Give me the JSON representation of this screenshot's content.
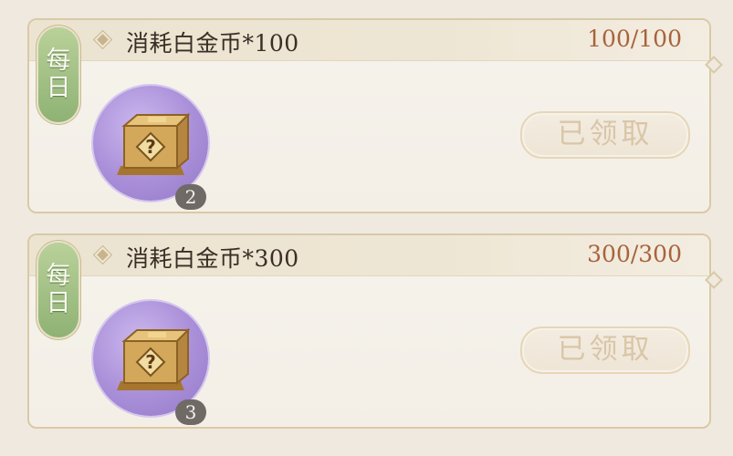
{
  "tasks": [
    {
      "tag_line1": "每",
      "tag_line2": "日",
      "title": "消耗白金币*100",
      "progress": "100/100",
      "reward_icon": "golden-mystery-box-icon",
      "reward_count": "2",
      "button_label": "已领取"
    },
    {
      "tag_line1": "每",
      "tag_line2": "日",
      "title": "消耗白金币*300",
      "progress": "300/300",
      "reward_icon": "golden-mystery-box-icon",
      "reward_count": "3",
      "button_label": "已领取"
    }
  ],
  "colors": {
    "progress_text": "#a8633c",
    "tag_green": "#9dbd80",
    "circle_purple": "#a98ed8",
    "button_text_disabled": "#d9c6a8"
  }
}
